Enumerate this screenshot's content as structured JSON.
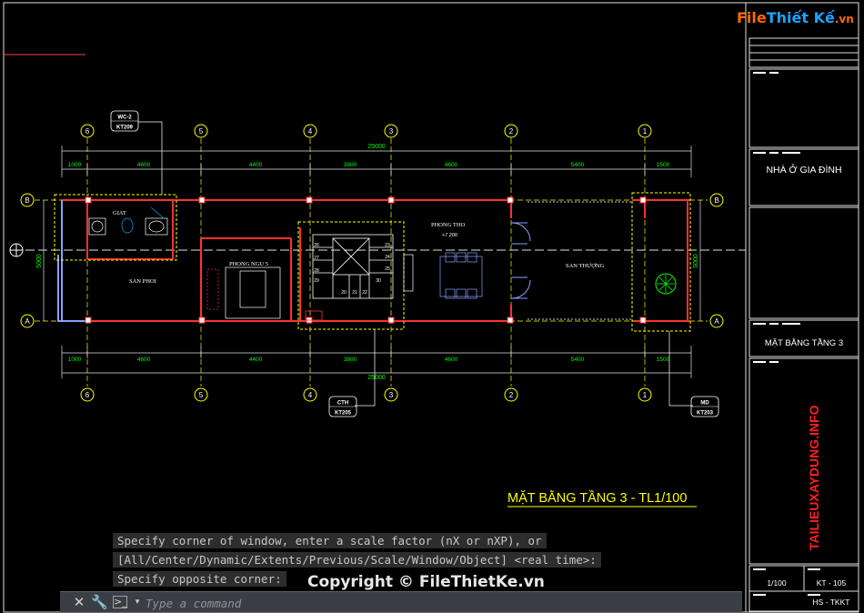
{
  "drawing": {
    "title": "MẶT BẰNG TẦNG 3 - TL1/100",
    "rooms": {
      "giat": "GIAT",
      "san_phoi": "SAN PHOI",
      "phong_ngu": "PHONG NGU 5",
      "phong_tho": "PHONG THO",
      "san_thuong": "SAN THƯỢNG",
      "level": "+7.200"
    },
    "axes_numbers": [
      "6",
      "5",
      "4",
      "3",
      "2",
      "1"
    ],
    "axes_letters": [
      "B",
      "A"
    ],
    "dims_top_total": "25000",
    "dims_bottom_total": "25000",
    "dims_segments": [
      "1000",
      "4600",
      "4400",
      "3800",
      "4600",
      "5400",
      "1500"
    ],
    "side_dim": "5000",
    "stair_numbers": [
      "20",
      "21",
      "22",
      "23",
      "24",
      "25",
      "26",
      "27",
      "28",
      "29",
      "30"
    ],
    "tags": [
      {
        "top": "WC-2",
        "bottom": "KT209"
      },
      {
        "top": "CTH",
        "bottom": "KT205"
      },
      {
        "top": "MD",
        "bottom": "KT203"
      }
    ]
  },
  "title_block": {
    "project": "NHÀ Ở GIA ĐÌNH",
    "sheet_name": "MẶT BẰNG TẦNG 3",
    "vertical_text": "TAILIEUXAYDUNG.INFO",
    "scale": "1/100",
    "sheet_no": "KT - 105",
    "stage": "HS - TKKT"
  },
  "command_line": {
    "history": [
      "Specify corner of window, enter a scale factor (nX or nXP), or",
      "[All/Center/Dynamic/Extents/Previous/Scale/Window/Object] <real time>:",
      "Specify opposite corner:"
    ],
    "placeholder": "Type a command"
  },
  "watermark": "Copyright © FileThietKe.vn",
  "logo": {
    "part1": "File",
    "part2": "Thiết Kế",
    "part3": ".vn"
  },
  "colors": {
    "wall": "#ff3030",
    "axis": "#ffff00",
    "dim": "#00ff00",
    "tag": "#ffffff",
    "title": "#ffff00",
    "vertical": "#ff2020"
  }
}
